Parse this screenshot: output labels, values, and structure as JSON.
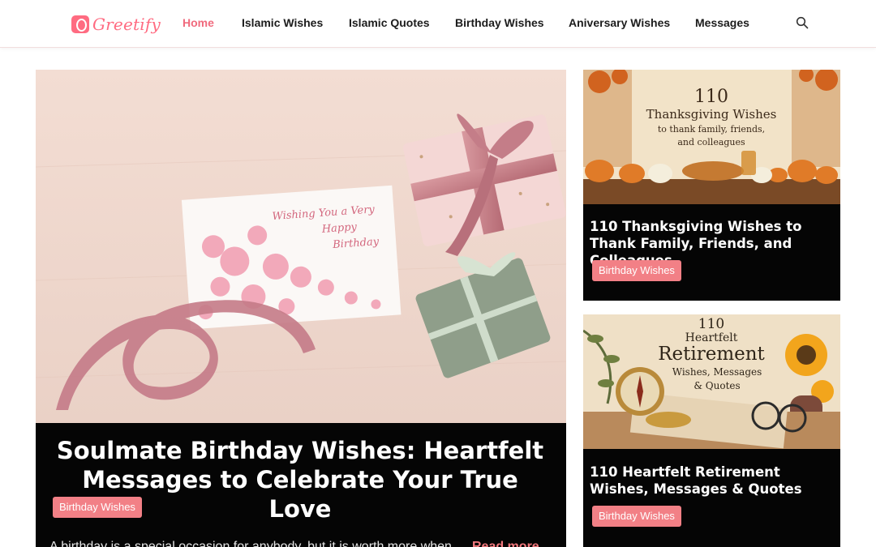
{
  "header": {
    "logo_text": "Greetify",
    "nav": [
      {
        "label": "Home",
        "active": true
      },
      {
        "label": "Islamic Wishes"
      },
      {
        "label": "Islamic Quotes"
      },
      {
        "label": "Birthday Wishes"
      },
      {
        "label": "Aniversary Wishes"
      },
      {
        "label": "Messages"
      }
    ],
    "search_icon": "search-icon"
  },
  "featured": {
    "image_text": [
      "Wishing You a Very",
      "Happy",
      "Birthday"
    ],
    "title": "Soulmate Birthday Wishes: Heartfelt Messages to Celebrate Your True Love",
    "category": "Birthday Wishes",
    "excerpt": "A birthday is a special occasion for anybody, but it is worth more when...",
    "read_more": "Read more"
  },
  "side_cards": [
    {
      "image_text": [
        "110",
        "Thanksgiving Wishes",
        "to thank family, friends,",
        "and colleagues"
      ],
      "title": "110 Thanksgiving Wishes to Thank Family, Friends, and Colleagues",
      "category": "Birthday Wishes"
    },
    {
      "image_text": [
        "110",
        "Heartfelt",
        "Retirement",
        "Wishes, Messages",
        "& Quotes"
      ],
      "title": "110 Heartfelt Retirement Wishes, Messages & Quotes",
      "category": "Birthday Wishes"
    }
  ],
  "colors": {
    "accent": "#f06a7d",
    "badge": "#f28086",
    "card_bg": "#050505"
  }
}
